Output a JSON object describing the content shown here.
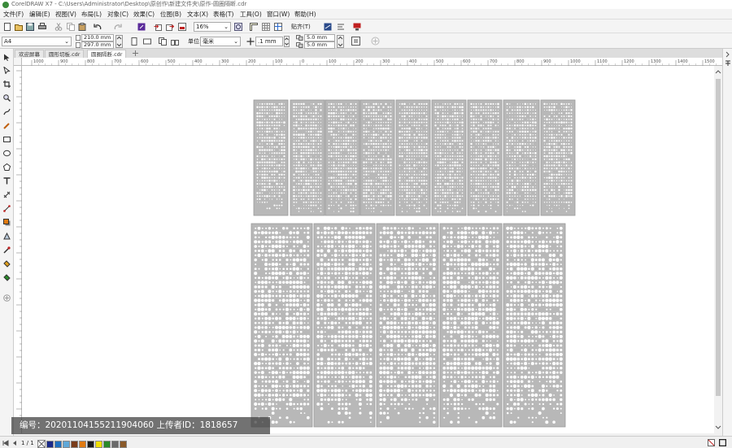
{
  "window": {
    "title": "CorelDRAW X7 - C:\\Users\\Administrator\\Desktop\\原创作\\新建文件夹\\原作-圆圈隔断.cdr"
  },
  "menu": [
    {
      "label": "文件(F)"
    },
    {
      "label": "编辑(E)"
    },
    {
      "label": "视图(V)"
    },
    {
      "label": "布局(L)"
    },
    {
      "label": "对象(C)"
    },
    {
      "label": "效果(C)"
    },
    {
      "label": "位图(B)"
    },
    {
      "label": "文本(X)"
    },
    {
      "label": "表格(T)"
    },
    {
      "label": "工具(O)"
    },
    {
      "label": "窗口(W)"
    },
    {
      "label": "帮助(H)"
    }
  ],
  "toolbar": {
    "zoom": "16%",
    "snap_label": "贴齐(T)"
  },
  "propbar": {
    "page_size": "A4",
    "width": "210.0 mm",
    "height": "297.0 mm",
    "units_label": "单位:",
    "units": "毫米",
    "nudge": ".1 mm",
    "dup_x": "5.0 mm",
    "dup_y": "5.0 mm"
  },
  "tabs": [
    {
      "label": "欢迎屏幕"
    },
    {
      "label": "圆形切板.cdr"
    },
    {
      "label": "圆圈隔断.cdr"
    }
  ],
  "ruler": {
    "h_ticks": [
      "1000",
      "900",
      "800",
      "700",
      "600",
      "500",
      "400",
      "300",
      "200",
      "100",
      "0",
      "100",
      "200",
      "300",
      "400",
      "500",
      "600",
      "700",
      "800",
      "900",
      "1000",
      "1100",
      "1200",
      "1300",
      "1400",
      "1500"
    ],
    "unit": "毫米"
  },
  "status": {
    "page_indicator": "1 / 1",
    "page_tab": "页1"
  },
  "palette": {
    "colors": [
      "#1a2a8a",
      "#1e6fc0",
      "#5fa8d8",
      "#7a3c1a",
      "#e07a10",
      "#1a1a1a",
      "#f0e000",
      "#2a8a2a",
      "#6a6a6a",
      "#8a5a2a",
      "#ffffff"
    ]
  },
  "watermark": {
    "text": "编号：20201104155211904060 上传者ID：1818657"
  },
  "panels": {
    "fill": "#b8b8b8",
    "dot_color": "#ffffff"
  }
}
